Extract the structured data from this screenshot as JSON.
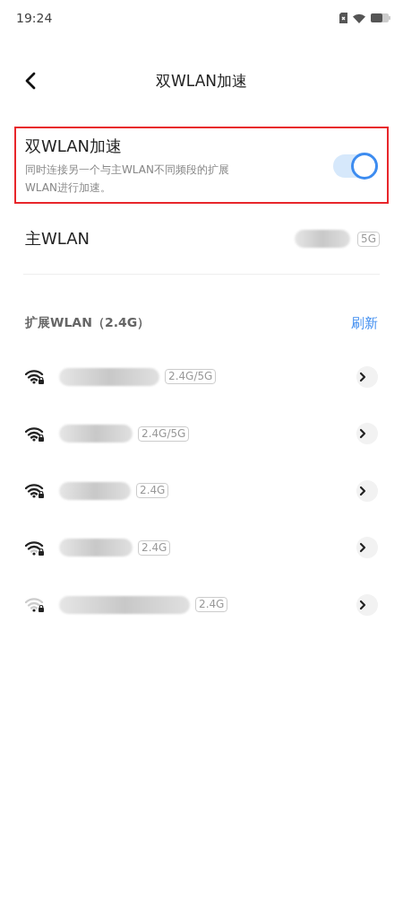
{
  "status_bar": {
    "time": "19:24"
  },
  "header": {
    "title": "双WLAN加速"
  },
  "dual_wlan": {
    "title": "双WLAN加速",
    "description": "同时连接另一个与主WLAN不同频段的扩展WLAN进行加速。",
    "on": true,
    "highlighted": true
  },
  "main_wlan": {
    "label": "主WLAN",
    "band": "5G"
  },
  "extended": {
    "title": "扩展WLAN（2.4G）",
    "refresh": "刷新",
    "networks": [
      {
        "kind": "full",
        "band": "2.4G/5G"
      },
      {
        "kind": "full",
        "band": "2.4G/5G"
      },
      {
        "kind": "full",
        "band": "2.4G"
      },
      {
        "kind": "medium",
        "band": "2.4G"
      },
      {
        "kind": "weak",
        "band": "2.4G"
      }
    ]
  }
}
